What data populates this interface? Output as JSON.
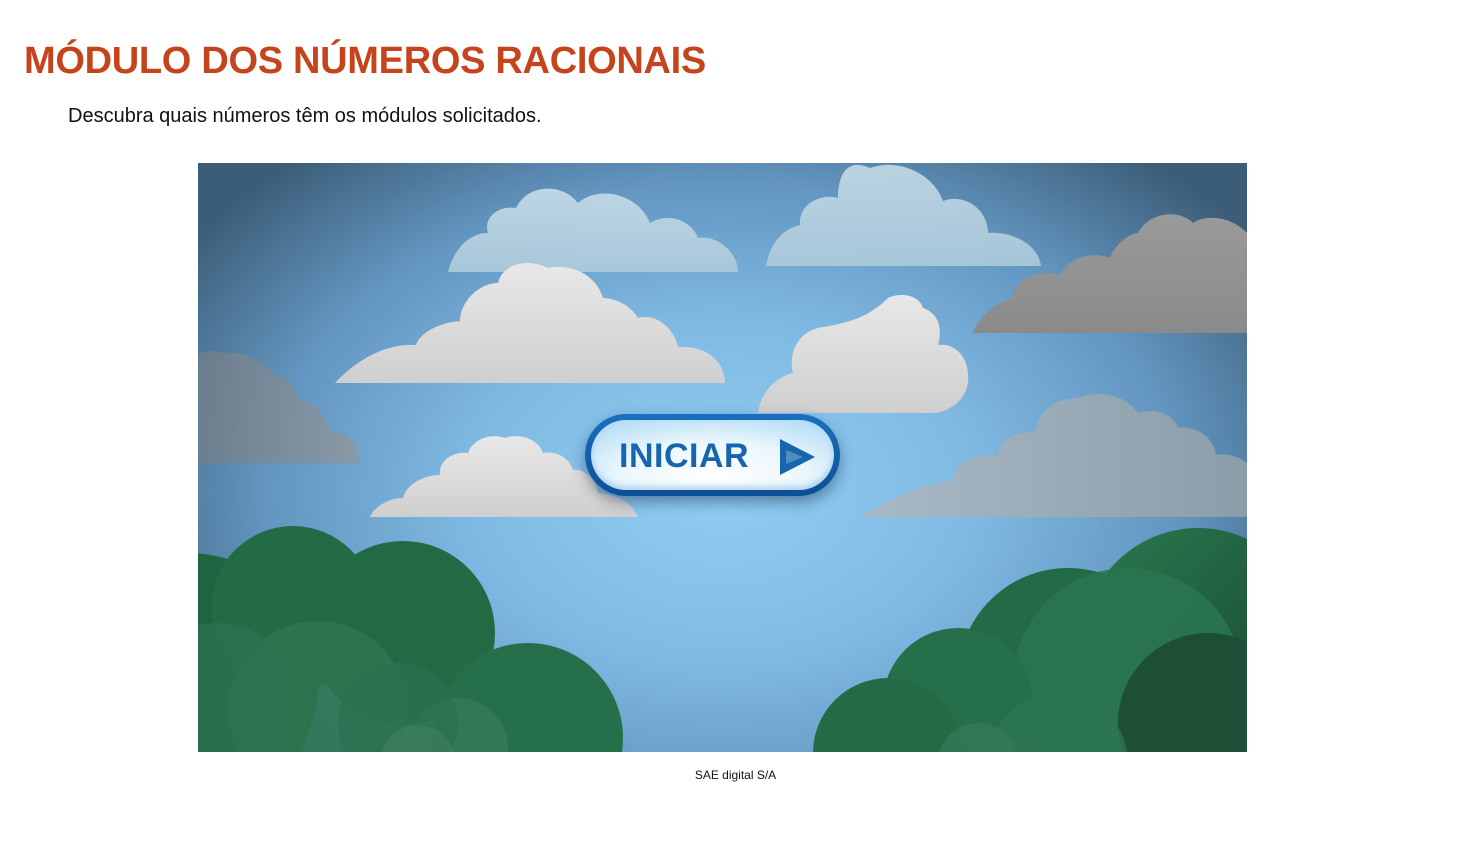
{
  "header": {
    "title": "MÓDULO DOS NÚMEROS RACIONAIS",
    "subtitle": "Descubra quais números têm os módulos solicitados."
  },
  "game": {
    "start_button_label": "INICIAR",
    "start_button_icon": "play-icon",
    "background_icons": [
      "cloud-icon",
      "bush-icon"
    ]
  },
  "footer": {
    "caption": "SAE digital S/A"
  },
  "colors": {
    "title": "#c5441c",
    "button_text": "#1765ae",
    "button_border": "#1a6fc1",
    "sky": "#90cdf2",
    "foliage": "#26704a"
  }
}
